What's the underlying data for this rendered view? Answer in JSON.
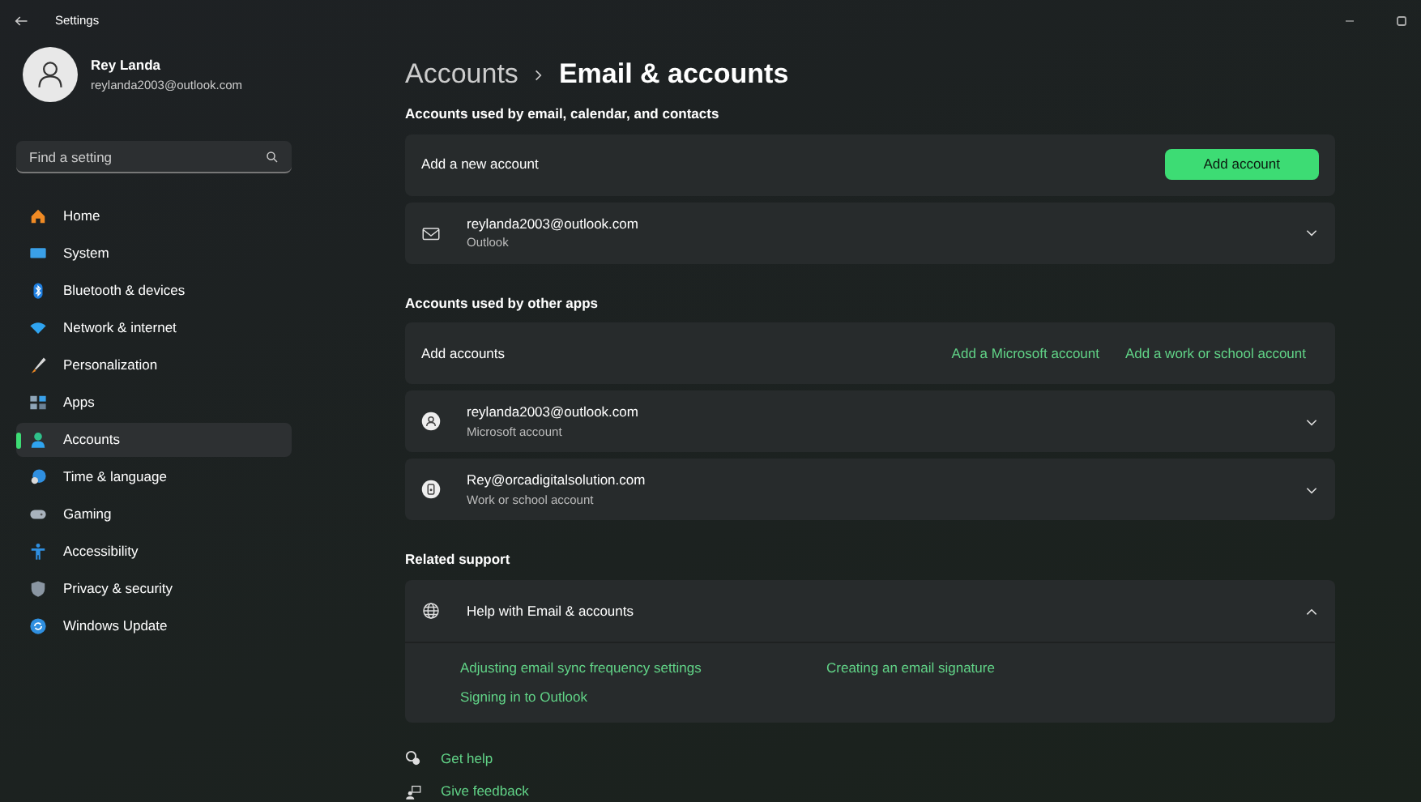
{
  "window": {
    "title": "Settings"
  },
  "profile": {
    "name": "Rey Landa",
    "email": "reylanda2003@outlook.com"
  },
  "search": {
    "placeholder": "Find a setting"
  },
  "sidebar": {
    "items": [
      {
        "label": "Home",
        "selected": false
      },
      {
        "label": "System",
        "selected": false
      },
      {
        "label": "Bluetooth & devices",
        "selected": false
      },
      {
        "label": "Network & internet",
        "selected": false
      },
      {
        "label": "Personalization",
        "selected": false
      },
      {
        "label": "Apps",
        "selected": false
      },
      {
        "label": "Accounts",
        "selected": true
      },
      {
        "label": "Time & language",
        "selected": false
      },
      {
        "label": "Gaming",
        "selected": false
      },
      {
        "label": "Accessibility",
        "selected": false
      },
      {
        "label": "Privacy & security",
        "selected": false
      },
      {
        "label": "Windows Update",
        "selected": false
      }
    ]
  },
  "breadcrumb": [
    {
      "label": "Accounts",
      "current": false
    },
    {
      "label": "Email & accounts",
      "current": true
    }
  ],
  "sections": [
    {
      "title": "Accounts used by email, calendar, and contacts",
      "cards": [
        {
          "kind": "action",
          "label": "Add a new account",
          "buttons": [
            "Add account"
          ]
        },
        {
          "kind": "account",
          "title": "reylanda2003@outlook.com",
          "subtitle": "Outlook",
          "expanded": false
        }
      ]
    },
    {
      "title": "Accounts used by other apps",
      "cards": [
        {
          "kind": "links",
          "label": "Add accounts",
          "links": [
            "Add a Microsoft account",
            "Add a work or school account"
          ]
        },
        {
          "kind": "account",
          "title": "reylanda2003@outlook.com",
          "subtitle": "Microsoft account",
          "expanded": false
        },
        {
          "kind": "account",
          "title": "Rey@orcadigitalsolution.com",
          "subtitle": "Work or school account",
          "expanded": false
        }
      ]
    },
    {
      "title": "Related support",
      "cards": [
        {
          "kind": "help",
          "title": "Help with Email & accounts",
          "expanded": true,
          "links": [
            "Adjusting email sync frequency settings",
            "Creating an email signature",
            "Signing in to Outlook"
          ]
        }
      ]
    }
  ],
  "footer_links": [
    "Get help",
    "Give feedback"
  ]
}
